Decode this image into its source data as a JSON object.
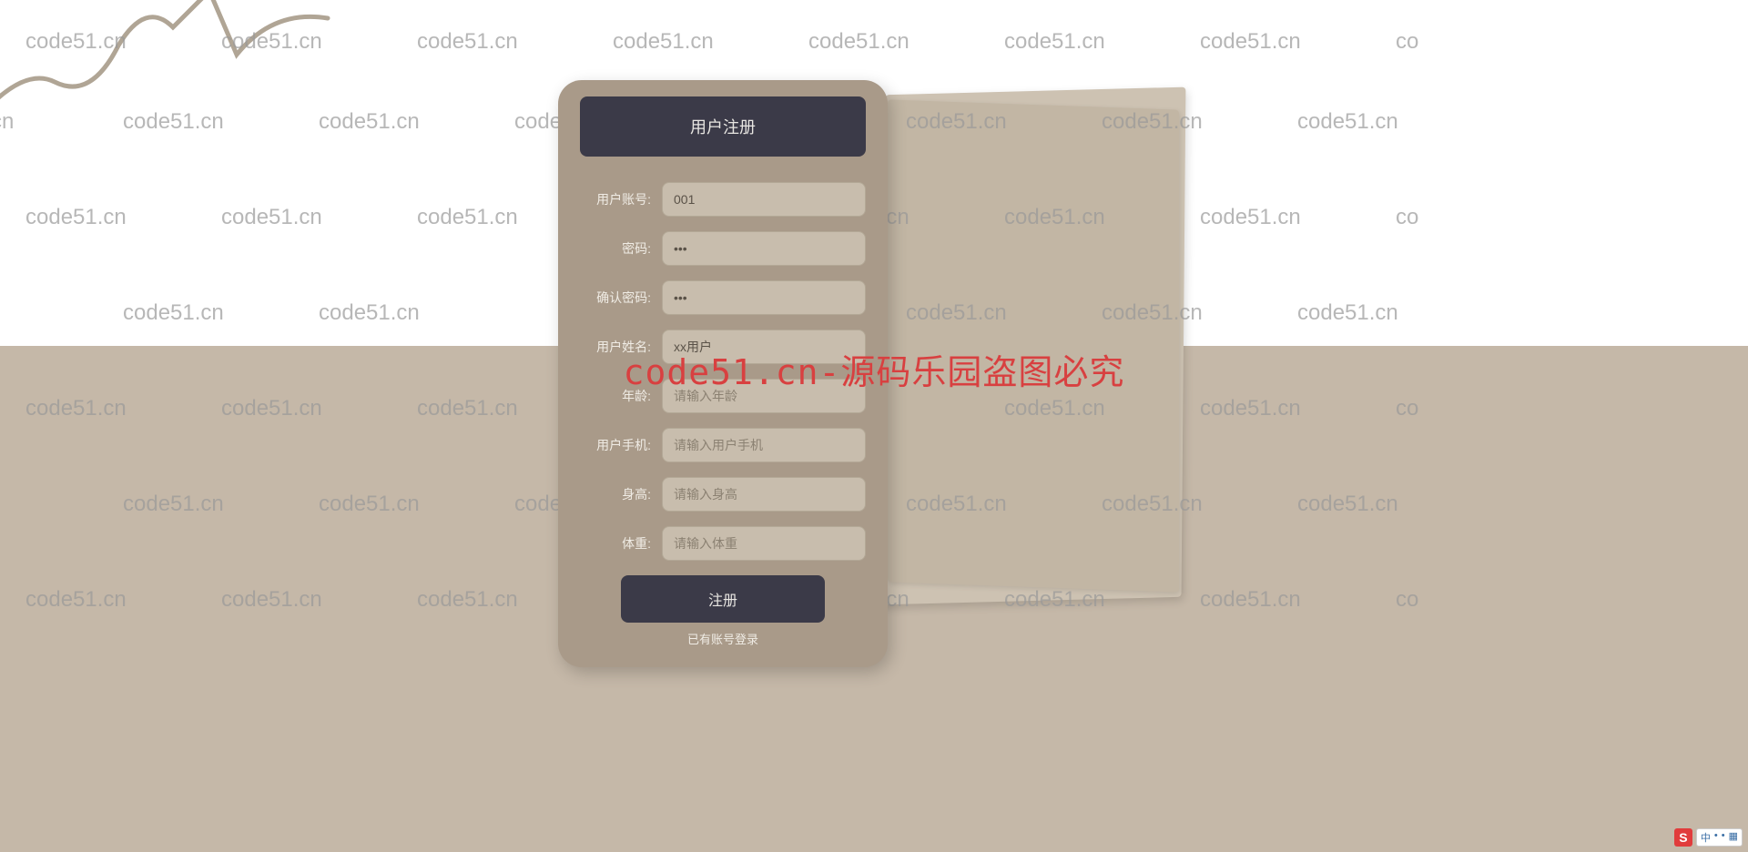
{
  "watermark": {
    "text": "code51.cn",
    "center": "code51.cn-源码乐园盗图必究"
  },
  "form": {
    "title": "用户注册",
    "fields": {
      "account": {
        "label": "用户账号:",
        "value": "001",
        "placeholder": ""
      },
      "password": {
        "label": "密码:",
        "value": "•••",
        "placeholder": ""
      },
      "confirm": {
        "label": "确认密码:",
        "value": "•••",
        "placeholder": ""
      },
      "name": {
        "label": "用户姓名:",
        "value": "xx用户",
        "placeholder": ""
      },
      "age": {
        "label": "年龄:",
        "value": "",
        "placeholder": "请输入年龄"
      },
      "phone": {
        "label": "用户手机:",
        "value": "",
        "placeholder": "请输入用户手机"
      },
      "height": {
        "label": "身高:",
        "value": "",
        "placeholder": "请输入身高"
      },
      "weight": {
        "label": "体重:",
        "value": "",
        "placeholder": "请输入体重"
      }
    },
    "submit": "注册",
    "login_link": "已有账号登录"
  },
  "ime": {
    "logo": "S",
    "items": [
      "中",
      "•",
      "•",
      "▦"
    ]
  }
}
